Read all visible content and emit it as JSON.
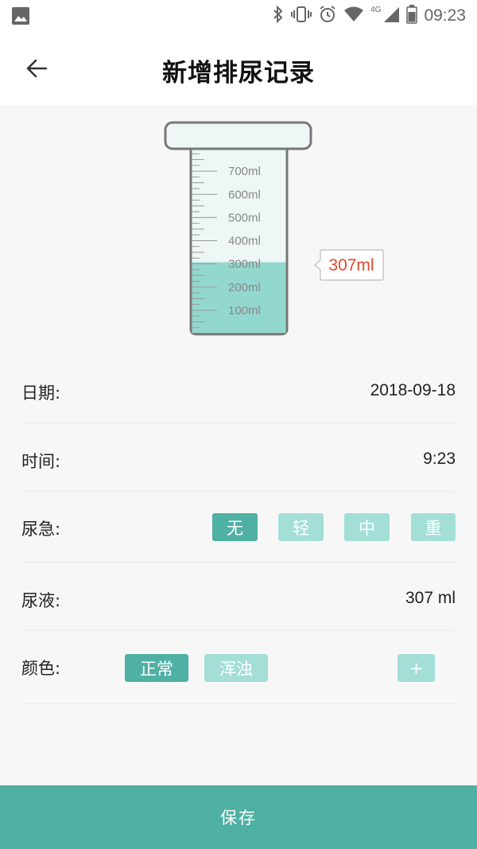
{
  "status_bar": {
    "time": "09:23",
    "network": "4G",
    "icons": [
      "image-icon",
      "bluetooth-icon",
      "vibrate-icon",
      "alarm-icon",
      "wifi-icon",
      "signal-icon",
      "battery-icon"
    ]
  },
  "header": {
    "title": "新增排尿记录",
    "back_icon": "arrow-left-icon"
  },
  "beaker": {
    "scale_labels": [
      "700ml",
      "600ml",
      "500ml",
      "400ml",
      "300ml",
      "200ml",
      "100ml"
    ],
    "fill_ml": 307,
    "capacity_ml": 800,
    "tooltip": "307ml",
    "colors": {
      "liquid": "#93d8cf",
      "glass": "#eef7f6",
      "outline": "#777777",
      "tooltip_text": "#e8452c"
    }
  },
  "form": {
    "date": {
      "label": "日期:",
      "value": "2018-09-18"
    },
    "time": {
      "label": "时间:",
      "value": "9:23"
    },
    "urgency": {
      "label": "尿急:",
      "options": [
        "无",
        "轻",
        "中",
        "重"
      ],
      "selected": "无"
    },
    "volume": {
      "label": "尿液:",
      "value": "307 ml"
    },
    "color": {
      "label": "颜色:",
      "options": [
        "正常",
        "浑浊"
      ],
      "selected": "正常",
      "add_label": "+"
    }
  },
  "footer": {
    "save_label": "保存"
  },
  "theme": {
    "accent": "#4fb0a4",
    "accent_light": "#a3ded7",
    "background": "#f7f7f7"
  }
}
